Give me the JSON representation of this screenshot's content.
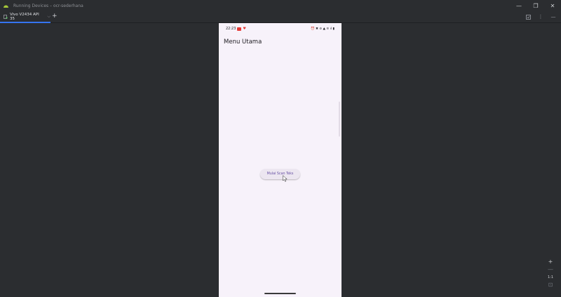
{
  "window": {
    "title": "Running Devices – ocr-sederhana",
    "controls": {
      "minimize": "—",
      "restore": "❐",
      "close": "✕"
    }
  },
  "tabs": [
    {
      "label": "Vivo V2434 API 35",
      "close": "⌵"
    }
  ],
  "tabbar": {
    "add": "+",
    "more": "⋮",
    "hide": "—"
  },
  "device": {
    "status": {
      "time": "22:23",
      "icons": "⏰ ✖ ⊘ ▲ ≋ ıl ▮"
    },
    "app_title": "Menu Utama",
    "button_label": "Mulai Scan Teks"
  },
  "zoom": {
    "in": "+",
    "out": "—",
    "reset": "1:1",
    "fit": "⊡"
  },
  "colors": {
    "accent": "#3574f0",
    "ide_bg": "#2b2d30",
    "device_bg": "#f7f2fa",
    "button_text": "#6750a4"
  }
}
